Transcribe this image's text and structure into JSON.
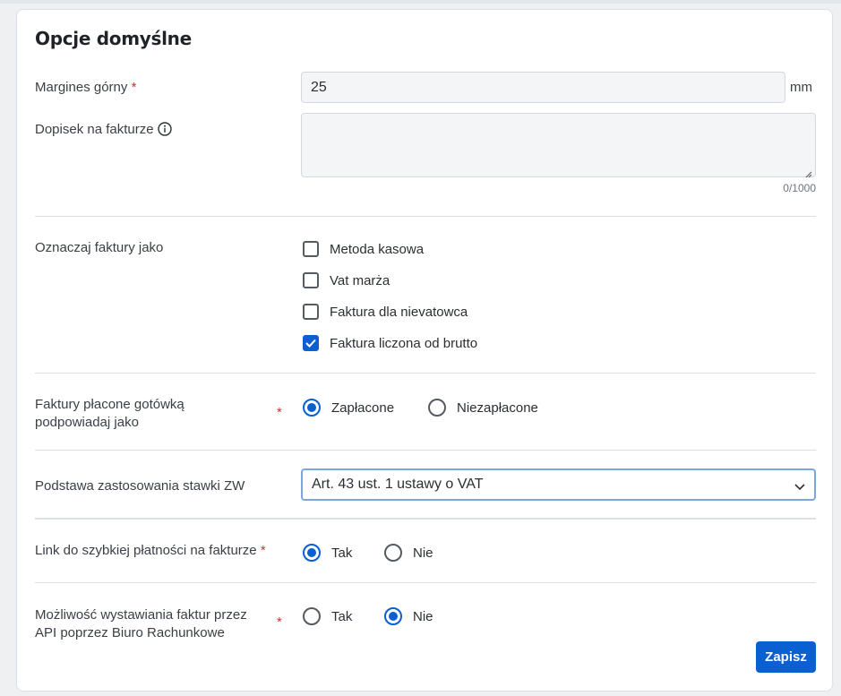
{
  "section_title": "Opcje domyślne",
  "top_margin": {
    "label": "Margines górny",
    "required_mark": "*",
    "value": "25",
    "unit": "mm"
  },
  "note": {
    "label": "Dopisek na fakturze",
    "counter": "0/1000"
  },
  "mark_invoices": {
    "label": "Oznaczaj faktury jako",
    "options": [
      {
        "label": "Metoda kasowa",
        "checked": false
      },
      {
        "label": "Vat marża",
        "checked": false
      },
      {
        "label": "Faktura dla nievatowca",
        "checked": false
      },
      {
        "label": "Faktura liczona od brutto",
        "checked": true
      }
    ]
  },
  "cash_paid": {
    "label_line1": "Faktury płacone gotówką",
    "label_line2": "podpowiadaj jako",
    "required_mark": "*",
    "options": [
      {
        "label": "Zapłacone",
        "checked": true
      },
      {
        "label": "Niezapłacone",
        "checked": false
      }
    ]
  },
  "zw_basis": {
    "label": "Podstawa zastosowania stawki ZW",
    "selected": "Art. 43 ust. 1 ustawy o VAT"
  },
  "quick_pay_link": {
    "label": "Link do szybkiej płatności na fakturze",
    "required_mark": "*",
    "options": [
      {
        "label": "Tak",
        "checked": true
      },
      {
        "label": "Nie",
        "checked": false
      }
    ]
  },
  "api_issue": {
    "label_line1": "Możliwość wystawiania faktur przez",
    "label_line2": "API poprzez Biuro Rachunkowe",
    "required_mark": "*",
    "options": [
      {
        "label": "Tak",
        "checked": false
      },
      {
        "label": "Nie",
        "checked": true
      }
    ]
  },
  "save_button": "Zapisz",
  "colors": {
    "accent": "#0a5fd1",
    "required": "#d32f2f",
    "border": "#dcdfe3"
  },
  "icons": [
    "info-icon",
    "checkmark-icon",
    "chevron-down-icon",
    "resize-handle-icon"
  ]
}
